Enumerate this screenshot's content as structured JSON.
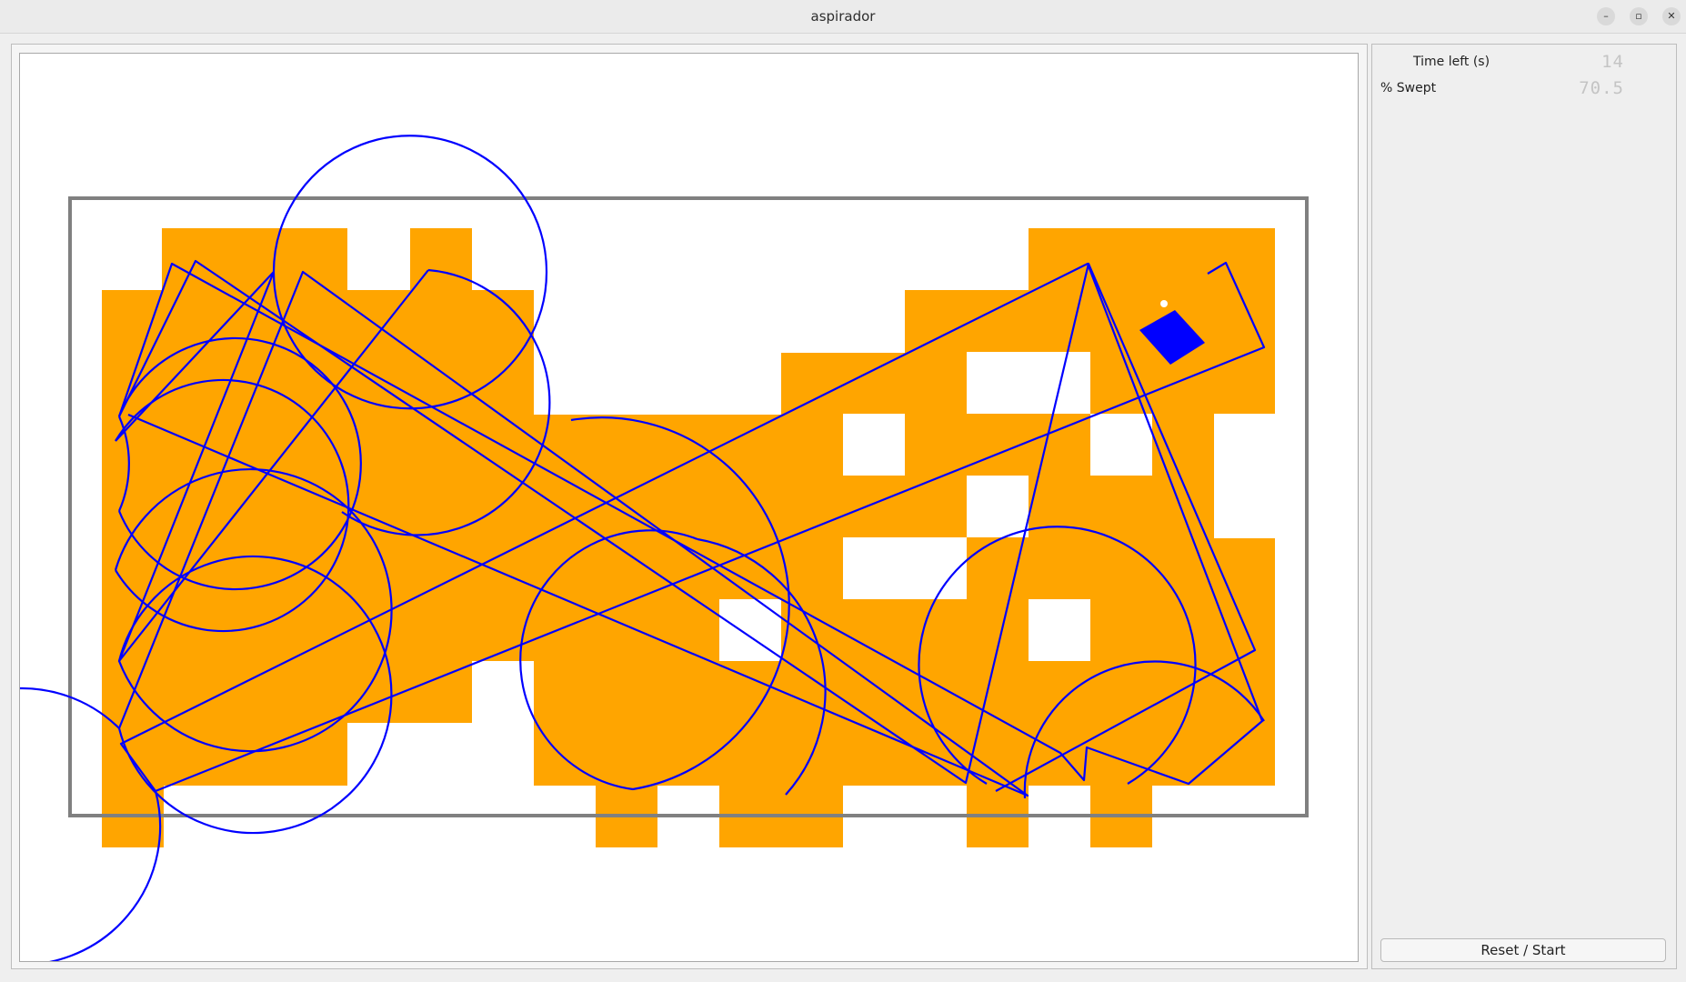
{
  "window": {
    "title": "aspirador",
    "controls": {
      "minimize": "–",
      "maximize": "▫",
      "close": "✕"
    }
  },
  "side_panel": {
    "time_left_label": "Time left (s)",
    "time_left_value": "14",
    "swept_label": "% Swept",
    "swept_value": "70.5",
    "reset_label": "Reset / Start"
  },
  "colors": {
    "swept": "#ffa500",
    "path": "#0000ff",
    "robot": "#0000ff",
    "border": "#808080"
  }
}
